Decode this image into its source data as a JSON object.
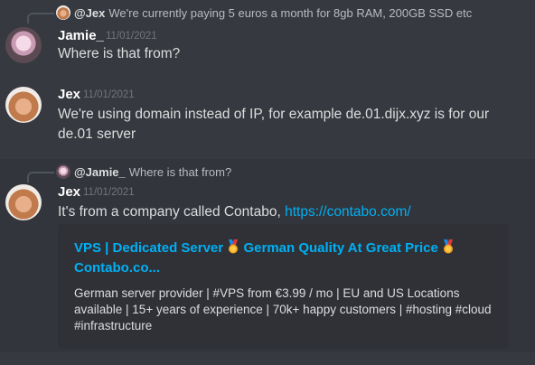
{
  "messages": [
    {
      "reply": {
        "mention": "@Jex",
        "text": "We're currently paying 5 euros a month for 8gb RAM, 200GB SSD etc"
      },
      "author": "Jamie_",
      "timestamp": "11/01/2021",
      "text": "Where is that from?"
    },
    {
      "author": "Jex",
      "timestamp": "11/01/2021",
      "text": "We're using domain instead of IP, for example de.01.dijx.xyz is for our de.01 server"
    },
    {
      "reply": {
        "mention": "@Jamie_",
        "text": "Where is that from?"
      },
      "author": "Jex",
      "timestamp": "11/01/2021",
      "text_prefix": "It's from a company called Contabo, ",
      "link": "https://contabo.com/",
      "embed": {
        "title_part1": "VPS | Dedicated Server",
        "title_part2": "German Quality At Great Price",
        "title_part3": "Contabo.co...",
        "description": "German server provider | #VPS from €3.99 / mo | EU and US Locations available | 15+ years of experience | 70k+ happy customers | #hosting #cloud #infrastructure"
      }
    }
  ],
  "colors": {
    "background": "#36393f",
    "link": "#00b0f4",
    "embed_bg": "#2f3136"
  },
  "icons": [
    "medal-icon"
  ]
}
